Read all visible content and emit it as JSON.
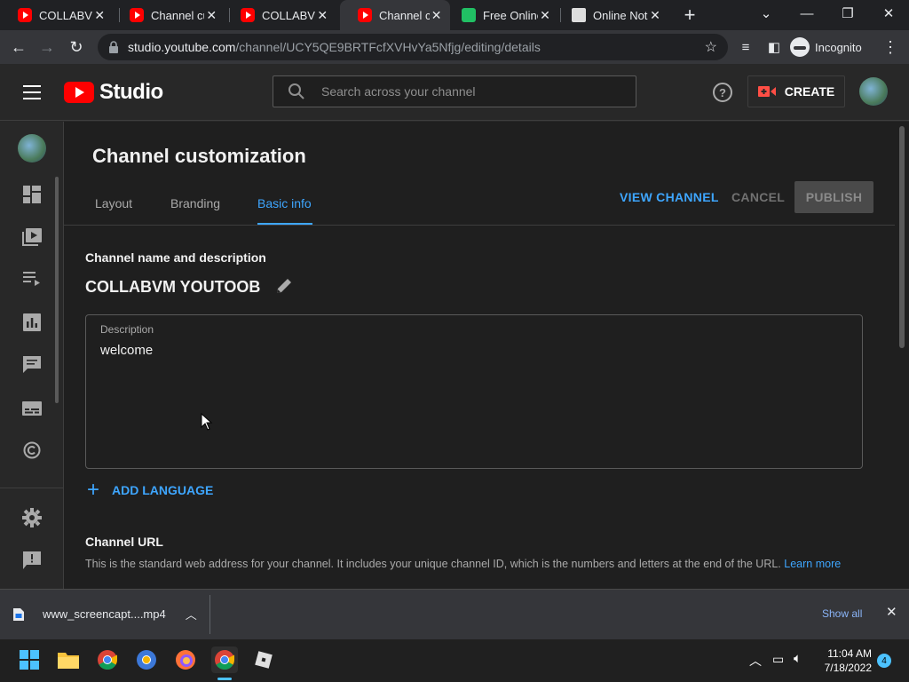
{
  "browser": {
    "tabs": [
      {
        "label": "COLLABVM",
        "icon": "youtube-icon",
        "active": false
      },
      {
        "label": "Channel cu",
        "icon": "youtube-icon",
        "active": false
      },
      {
        "label": "COLLABVM",
        "icon": "youtube-icon",
        "active": false
      },
      {
        "label": "Channel cu",
        "icon": "youtube-icon",
        "active": true
      },
      {
        "label": "Free Online",
        "icon": "green-app-icon",
        "active": false
      },
      {
        "label": "Online Not",
        "icon": "notepad-icon",
        "active": false
      }
    ],
    "url_host": "studio.youtube.com",
    "url_path": "/channel/UCY5QE9BRTFcfXVHvYa5Nfjg/editing/details",
    "incognito_label": "Incognito"
  },
  "header": {
    "logo_text": "Studio",
    "search_placeholder": "Search across your channel",
    "create_label": "CREATE"
  },
  "page": {
    "title": "Channel customization",
    "tabs": [
      "Layout",
      "Branding",
      "Basic info"
    ],
    "active_tab": "Basic info",
    "view_channel": "VIEW CHANNEL",
    "cancel": "CANCEL",
    "publish": "PUBLISH",
    "section_name_desc": "Channel name and description",
    "channel_name": "COLLABVM YOUTOOB",
    "description_label": "Description",
    "description_value": "welcome",
    "add_language": "ADD LANGUAGE",
    "section_url": "Channel URL",
    "url_help": "This is the standard web address for your channel. It includes your unique channel ID, which is the numbers and letters at the end of the URL.",
    "learn_more": "Learn more"
  },
  "downloads": {
    "file_name": "www_screencapt....mp4",
    "show_all": "Show all"
  },
  "taskbar": {
    "time": "11:04 AM",
    "date": "7/18/2022",
    "notification_count": "4"
  },
  "colors": {
    "accent_blue": "#3ea6ff",
    "youtube_red": "#ff0000",
    "background": "#1f1f1f"
  }
}
